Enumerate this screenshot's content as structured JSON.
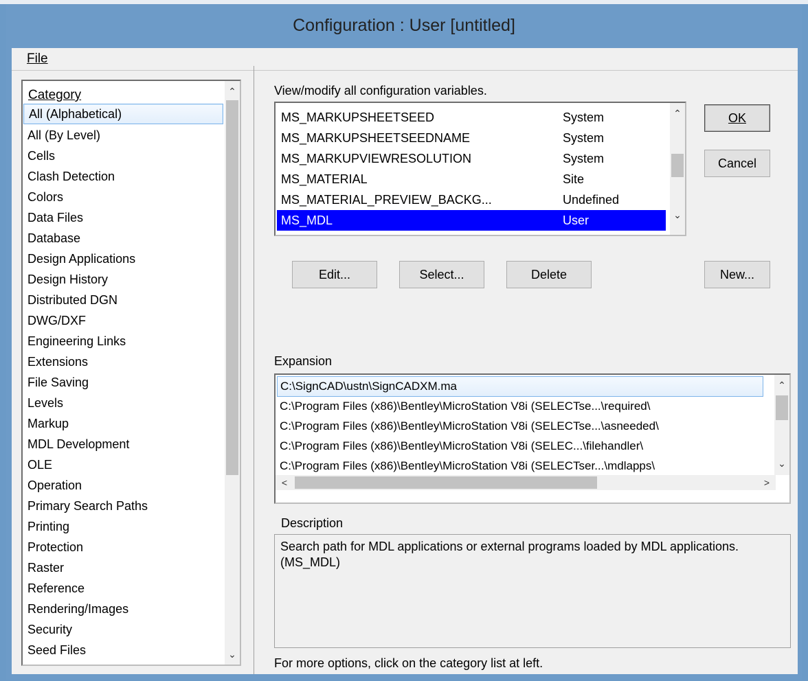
{
  "window": {
    "title": "Configuration : User [untitled]"
  },
  "menubar": {
    "file_label": "File"
  },
  "category": {
    "header": "Category",
    "items": [
      "All (Alphabetical)",
      "All (By Level)",
      "Cells",
      "Clash Detection",
      "Colors",
      "Data Files",
      "Database",
      "Design Applications",
      "Design History",
      "Distributed DGN",
      "DWG/DXF",
      "Engineering Links",
      "Extensions",
      "File Saving",
      "Levels",
      "Markup",
      "MDL Development",
      "OLE",
      "Operation",
      "Primary Search Paths",
      "Printing",
      "Protection",
      "Raster",
      "Reference",
      "Rendering/Images",
      "Security",
      "Seed Files"
    ],
    "selected_index": 0
  },
  "variables": {
    "heading": "View/modify all configuration variables.",
    "rows": [
      {
        "name": "MS_MARKUPSHEETSEED",
        "level": "System"
      },
      {
        "name": "MS_MARKUPSHEETSEEDNAME",
        "level": "System"
      },
      {
        "name": "MS_MARKUPVIEWRESOLUTION",
        "level": "System"
      },
      {
        "name": "MS_MATERIAL",
        "level": "Site"
      },
      {
        "name": "MS_MATERIAL_PREVIEW_BACKG...",
        "level": "Undefined"
      },
      {
        "name": "MS_MDL",
        "level": "User"
      }
    ],
    "selected_index": 5
  },
  "buttons": {
    "ok": "OK",
    "cancel": "Cancel",
    "edit": "Edit...",
    "select": "Select...",
    "delete": "Delete",
    "new": "New..."
  },
  "expansion": {
    "label": "Expansion",
    "rows": [
      "C:\\SignCAD\\ustn\\SignCADXM.ma",
      "C:\\Program Files (x86)\\Bentley\\MicroStation V8i (SELECTse...\\required\\",
      "C:\\Program Files (x86)\\Bentley\\MicroStation V8i (SELECTse...\\asneeded\\",
      "C:\\Program Files (x86)\\Bentley\\MicroStation V8i (SELEC...\\filehandler\\",
      "C:\\Program Files (x86)\\Bentley\\MicroStation V8i (SELECTser...\\mdlapps\\"
    ]
  },
  "description": {
    "label": "Description",
    "text": "Search path for MDL applications or external programs loaded by MDL applications.  (MS_MDL)"
  },
  "footer": {
    "hint": "For more options, click on the category list at left."
  }
}
